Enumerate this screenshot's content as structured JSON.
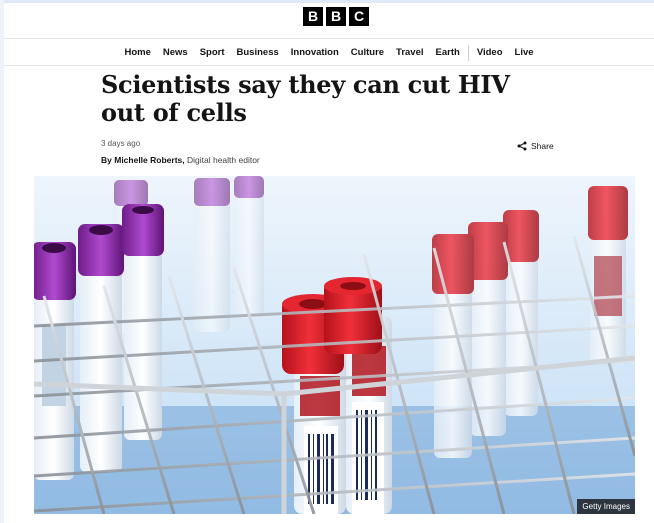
{
  "masthead": {
    "logo_letters": [
      "B",
      "B",
      "C"
    ]
  },
  "nav": {
    "items": [
      {
        "label": "Home"
      },
      {
        "label": "News"
      },
      {
        "label": "Sport"
      },
      {
        "label": "Business"
      },
      {
        "label": "Innovation"
      },
      {
        "label": "Culture"
      },
      {
        "label": "Travel"
      },
      {
        "label": "Earth"
      },
      {
        "label": "Video"
      },
      {
        "label": "Live"
      }
    ]
  },
  "article": {
    "headline": "Scientists say they can cut HIV out of cells",
    "timestamp": "3 days ago",
    "byline_prefix": "By ",
    "author": "Michelle Roberts,",
    "author_role": " Digital health editor",
    "share_label": "Share",
    "image_credit": "Getty Images"
  },
  "colors": {
    "cap_red": "#e1202a",
    "cap_purple": "#9a2fb8",
    "background_blue": "#dfeefc"
  }
}
